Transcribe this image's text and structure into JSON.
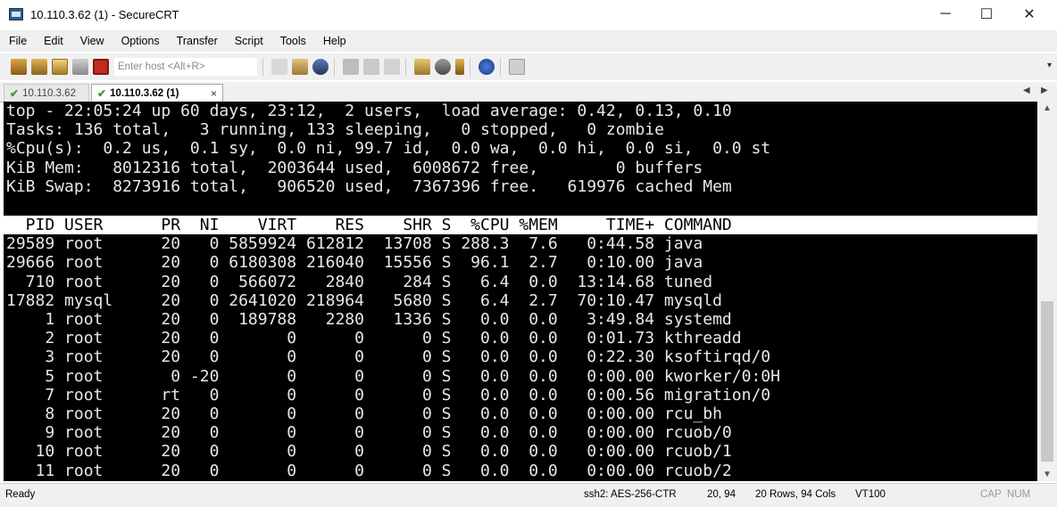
{
  "window": {
    "title": "10.110.3.62 (1) - SecureCRT",
    "minimize_glyph": "─",
    "maximize_glyph": "☐",
    "close_glyph": "✕"
  },
  "menu": [
    "File",
    "Edit",
    "View",
    "Options",
    "Transfer",
    "Script",
    "Tools",
    "Help"
  ],
  "toolbar": {
    "enter_host_placeholder": "Enter host <Alt+R>",
    "icons": [
      "connect-icon",
      "quick-connect-icon",
      "connect-in-tab-icon",
      "reconnect-icon",
      "disconnect-icon",
      "copy-icon",
      "paste-icon",
      "find-icon",
      "print-icon",
      "print-setup-icon",
      "log-session-icon",
      "session-options-icon",
      "global-options-icon",
      "key-icon",
      "help-icon",
      "map-icon"
    ]
  },
  "tabs": [
    {
      "label": "10.110.3.62",
      "active": false
    },
    {
      "label": "10.110.3.62 (1)",
      "active": true
    }
  ],
  "tab_close_glyph": "×",
  "tab_nav": {
    "left": "◀",
    "right": "▶"
  },
  "terminal": {
    "summary": [
      "top - 22:05:24 up 60 days, 23:12,  2 users,  load average: 0.42, 0.13, 0.10",
      "Tasks: 136 total,   3 running, 133 sleeping,   0 stopped,   0 zombie",
      "%Cpu(s):  0.2 us,  0.1 sy,  0.0 ni, 99.7 id,  0.0 wa,  0.0 hi,  0.0 si,  0.0 st",
      "KiB Mem:   8012316 total,  2003644 used,  6008672 free,        0 buffers",
      "KiB Swap:  8273916 total,   906520 used,  7367396 free.   619976 cached Mem"
    ],
    "header": "  PID USER      PR  NI    VIRT    RES    SHR S  %CPU %MEM     TIME+ COMMAND",
    "processes": [
      "29589 root      20   0 5859924 612812  13708 S 288.3  7.6   0:44.58 java",
      "29666 root      20   0 6180308 216040  15556 S  96.1  2.7   0:10.00 java",
      "  710 root      20   0  566072   2840    284 S   6.4  0.0  13:14.68 tuned",
      "17882 mysql     20   0 2641020 218964   5680 S   6.4  2.7  70:10.47 mysqld",
      "    1 root      20   0  189788   2280   1336 S   0.0  0.0   3:49.84 systemd",
      "    2 root      20   0       0      0      0 S   0.0  0.0   0:01.73 kthreadd",
      "    3 root      20   0       0      0      0 S   0.0  0.0   0:22.30 ksoftirqd/0",
      "    5 root       0 -20       0      0      0 S   0.0  0.0   0:00.00 kworker/0:0H",
      "    7 root      rt   0       0      0      0 S   0.0  0.0   0:00.56 migration/0",
      "    8 root      20   0       0      0      0 S   0.0  0.0   0:00.00 rcu_bh",
      "    9 root      20   0       0      0      0 S   0.0  0.0   0:00.00 rcuob/0",
      "   10 root      20   0       0      0      0 S   0.0  0.0   0:00.00 rcuob/1",
      "   11 root      20   0       0      0      0 S   0.0  0.0   0:00.00 rcuob/2"
    ]
  },
  "statusbar": {
    "ready": "Ready",
    "cipher": "ssh2: AES-256-CTR",
    "cursor": "20, 94",
    "size": "20 Rows, 94 Cols",
    "term_type": "VT100",
    "caps": "CAP",
    "num": "NUM"
  }
}
